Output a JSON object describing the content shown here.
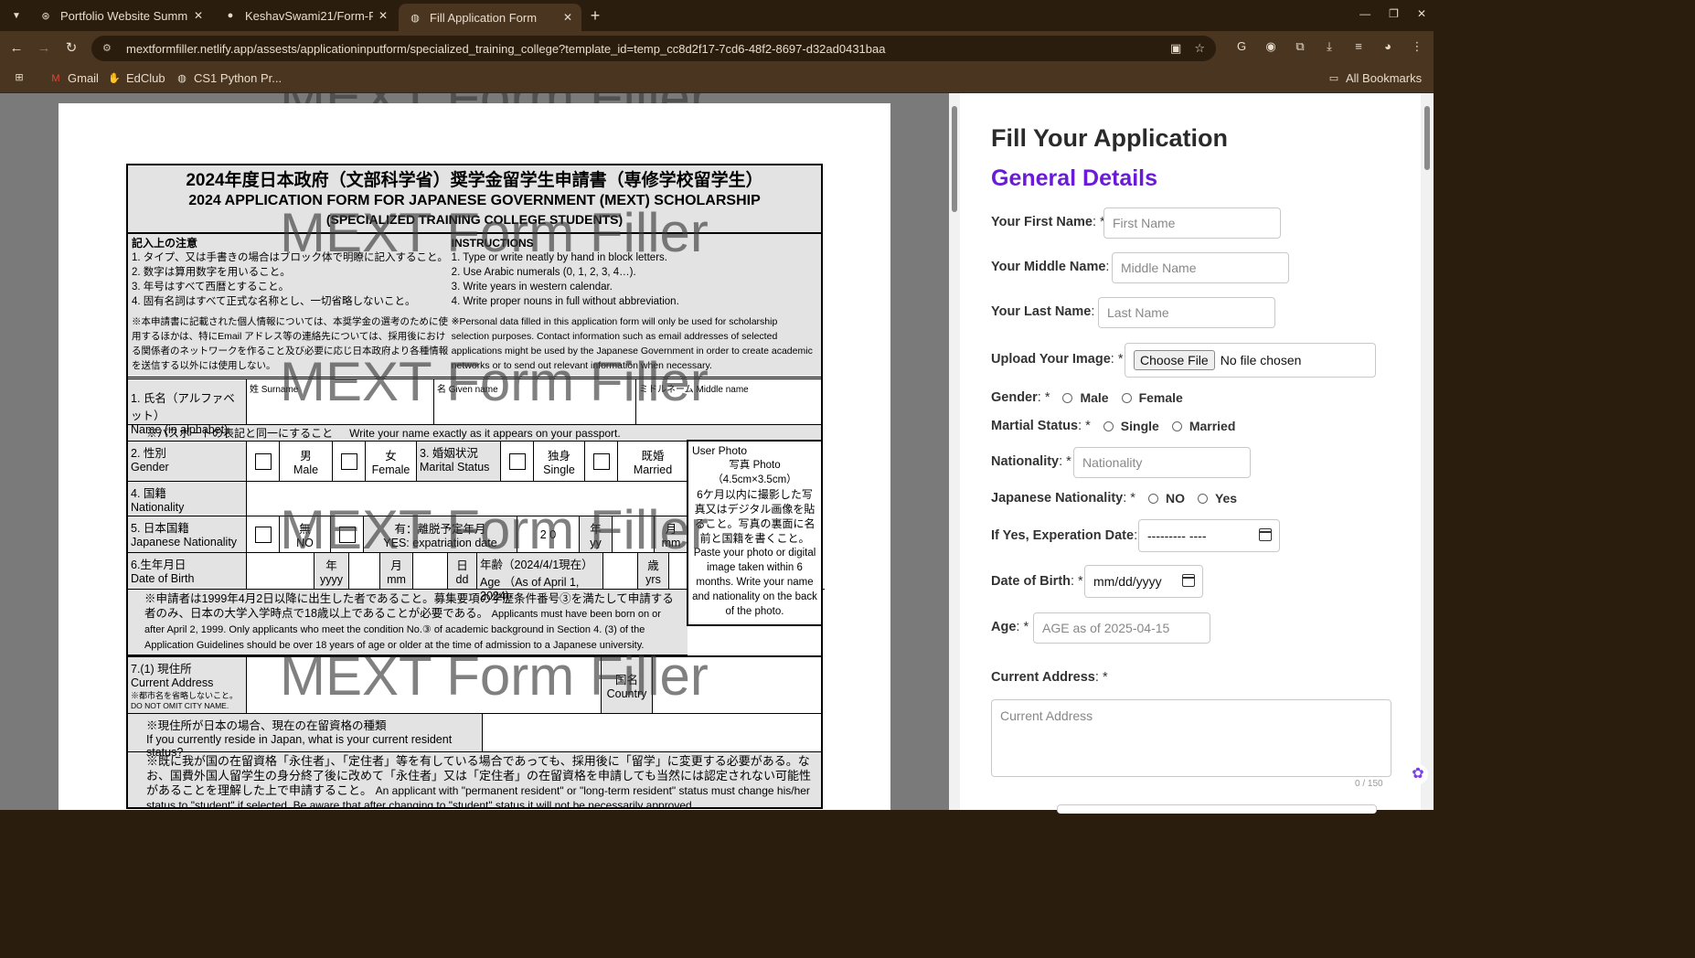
{
  "browser": {
    "tabs": [
      {
        "title": "Portfolio Website Summ",
        "active": false,
        "icon": "openai-icon"
      },
      {
        "title": "KeshavSwami21/Form-Fi",
        "active": false,
        "icon": "github-icon"
      },
      {
        "title": "Fill Application Form",
        "active": true,
        "icon": "globe-icon"
      }
    ],
    "url": "mextformfiller.netlify.app/assests/applicationinputform/specialized_training_college?template_id=temp_cc8d2f17-7cd6-48f2-8697-d32ad0431baa",
    "bookmarks": [
      {
        "label": "Gmail",
        "icon": "gmail-icon"
      },
      {
        "label": "EdClub",
        "icon": "edclub-icon"
      },
      {
        "label": "CS1 Python Pr...",
        "icon": "globe-icon"
      }
    ],
    "all_bookmarks": "All Bookmarks"
  },
  "preview": {
    "watermark": "MEXT Form Filler",
    "title_jp": "2024年度日本政府（文部科学省）奨学金留学生申請書（専修学校留学生）",
    "title_en": "2024 APPLICATION FORM FOR JAPANESE GOVERNMENT (MEXT) SCHOLARSHIP",
    "title_en2": "(SPECIALIZED TRAINING COLLEGE STUDENTS)",
    "instr_jp_head": "記入上の注意",
    "instr_en_head": "INSTRUCTIONS",
    "instr_jp": [
      "1. タイプ、又は手書きの場合はブロック体で明瞭に記入すること。",
      "2. 数字は算用数字を用いること。",
      "3. 年号はすべて西暦とすること。",
      "4. 固有名詞はすべて正式な名称とし、一切省略しないこと。"
    ],
    "instr_en": [
      "1. Type or write neatly by hand in block letters.",
      "2. Use Arabic numerals (0, 1, 2, 3, 4…).",
      "3. Write years in western calendar.",
      "4. Write proper nouns in full without abbreviation."
    ],
    "privacy_jp": "※本申請書に記載された個人情報については、本奨学金の選考のために使用するほかは、特にEmail アドレス等の連絡先については、採用後における関係者のネットワークを作ること及び必要に応じ日本政府より各種情報を送信する以外には使用しない。",
    "privacy_en": "※Personal data filled in this application form will only be used for scholarship selection purposes. Contact information such as email addresses of selected applications might be used by the Japanese Government in order to create academic networks or to send out relevant information when necessary.",
    "name_label_jp": "1. 氏名（アルファベット）",
    "name_label_en": "Name (in alphabet)",
    "surname": "姓 Surname",
    "given": "名 Given name",
    "middle": "ミドルネーム Middle name",
    "passport_note_jp": "※パスポートの表記と同一にすること",
    "passport_note_en": "Write your name exactly as it appears on your passport.",
    "gender_jp": "2. 性別",
    "gender_en": "Gender",
    "male_jp": "男",
    "male_en": "Male",
    "female_jp": "女",
    "female_en": "Female",
    "marital_jp": "3. 婚姻状況",
    "marital_en": "Marital Status",
    "single_jp": "独身",
    "single_en": "Single",
    "married_jp": "既婚",
    "married_en": "Married",
    "nationality_jp": "4. 国籍",
    "nationality_en": "Nationality",
    "jpnat_jp": "5. 日本国籍",
    "jpnat_en": "Japanese Nationality",
    "no_jp": "無",
    "no_en": "NO",
    "yes_jp": "有：離脱予定年月",
    "yes_en": "YES: expatriation date",
    "yy": "2 0",
    "year_jp": "年",
    "year_en": "yy",
    "month_jp": "月",
    "month_en": "mm",
    "dob_jp": "6.生年月日",
    "dob_en": "Date of Birth",
    "yyyy": "yyyy",
    "dd_jp": "日",
    "dd_en": "dd",
    "age_jp": "年齢（2024/4/1現在）",
    "age_en": "Age （As of April 1, 2024)",
    "yrs_jp": "歳",
    "yrs_en": "yrs",
    "dob_note_jp": "※申請者は1999年4月2日以降に出生した者であること。募集要項の学歴条件番号③を満たして申請する者のみ、日本の大学入学時点で18歳以上であることが必要である。",
    "dob_note_en": "Applicants must have been born on or after April 2, 1999. Only applicants who meet the condition No.③ of academic background in Section 4. (3) of the Application Guidelines should be over 18 years of age or older at the time of admission to a Japanese university.",
    "photo_alt": "User Photo",
    "photo_jp_title": "写真 Photo",
    "photo_size": "（4.5cm×3.5cm）",
    "photo_jp": "6ケ月以内に撮影した写真又はデジタル画像を貼ること。写真の裏面に名前と国籍を書くこと。",
    "photo_en": "Paste your photo or digital image taken within 6 months. Write your name and nationality on the back of the photo.",
    "addr_jp": "7.(1) 現住所",
    "addr_en": "Current Address",
    "addr_note_jp": "※都市名を省略しないこと。",
    "addr_note_en": "DO NOT OMIT CITY NAME.",
    "country_jp": "国名",
    "country_en": "Country",
    "resident_jp": "※現住所が日本の場合、現在の在留資格の種類",
    "resident_en": "If you currently reside in Japan, what is your current resident status?",
    "status_jp": "※既に我が国の在留資格「永住者」、「定住者」等を有している場合であっても、採用後に「留学」に変更する必要がある。なお、国費外国人留学生の身分終了後に改めて「永住者」又は「定住者」の在留資格を申請しても当然には認定されない可能性があることを理解した上で申請すること。",
    "status_en": "An applicant with \"permanent resident\" or \"long-term resident\" status must change his/her status to \"student\" if selected. Be aware that after changing to \"student\" status it will not be necessarily approved"
  },
  "form": {
    "heading": "Fill Your Application",
    "section": "General Details",
    "first_name": {
      "label": "Your First Name",
      "suffix": ": *",
      "placeholder": "First Name"
    },
    "middle_name": {
      "label": "Your Middle Name",
      "suffix": ":",
      "placeholder": "Middle Name"
    },
    "last_name": {
      "label": "Your Last Name",
      "suffix": ":",
      "placeholder": "Last Name"
    },
    "image": {
      "label": "Upload Your Image",
      "suffix": ": *",
      "button": "Choose File",
      "status": "No file chosen"
    },
    "gender": {
      "label": "Gender",
      "suffix": ": *",
      "options": [
        "Male",
        "Female"
      ]
    },
    "marital": {
      "label": "Martial Status",
      "suffix": ": *",
      "options": [
        "Single",
        "Married"
      ]
    },
    "nationality": {
      "label": "Nationality",
      "suffix": ": *",
      "placeholder": "Nationality"
    },
    "jp_nationality": {
      "label": "Japanese Nationality",
      "suffix": ": *",
      "options": [
        "NO",
        "Yes"
      ]
    },
    "expiration": {
      "label": "If Yes, Experation Date",
      "suffix": ":",
      "value": "---------  ----"
    },
    "dob": {
      "label": "Date of Birth",
      "suffix": ": *",
      "value": "mm/dd/yyyy"
    },
    "age": {
      "label": "Age",
      "suffix": ": *",
      "placeholder": "AGE as of 2025-04-15"
    },
    "address": {
      "label": "Current Address",
      "suffix": ": *",
      "placeholder": "Current Address",
      "counter": "0 / 150"
    }
  }
}
